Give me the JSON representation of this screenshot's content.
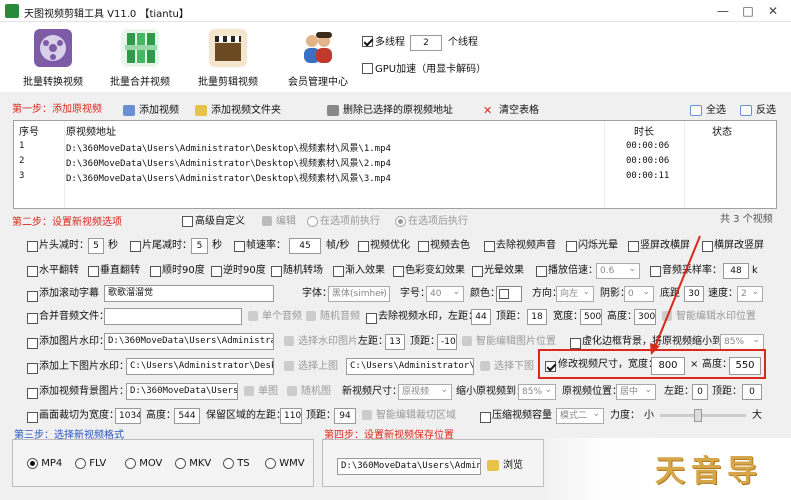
{
  "window": {
    "title": "天图视频剪辑工具 V11.0 【tiantu】",
    "minimize": "—",
    "maximize": "□",
    "close": "✕"
  },
  "toolbar": {
    "buttons": [
      {
        "label": "批量转换视频",
        "icon": "film-reel-icon",
        "color": "#7d5ba6"
      },
      {
        "label": "批量合并视频",
        "icon": "merge-blocks-icon",
        "color": "#2f9a4a"
      },
      {
        "label": "批量剪辑视频",
        "icon": "clapper-icon",
        "color": "#c07b2b"
      },
      {
        "label": "会员管理中心",
        "icon": "users-icon",
        "color": "#3b6fc4"
      }
    ],
    "multithread_label": "多线程",
    "thread_count": "2",
    "thread_unit": "个线程",
    "gpu_label": "GPU加速（用显卡解码）"
  },
  "step1": {
    "title": "第一步：添加原视频",
    "add_video": "添加视频",
    "add_folder": "添加视频文件夹",
    "delete_selected": "删除已选择的原视频地址",
    "clear_table": "清空表格",
    "select_all": "全选",
    "invert": "反选"
  },
  "table": {
    "headers": [
      "序号",
      "原视频地址",
      "时长",
      "状态"
    ],
    "rows": [
      {
        "index": "1",
        "path": "D:\\360MoveData\\Users\\Administrator\\Desktop\\视频素材\\风景\\1.mp4",
        "duration": "00:00:06",
        "status": ""
      },
      {
        "index": "2",
        "path": "D:\\360MoveData\\Users\\Administrator\\Desktop\\视频素材\\风景\\2.mp4",
        "duration": "00:00:06",
        "status": ""
      },
      {
        "index": "3",
        "path": "D:\\360MoveData\\Users\\Administrator\\Desktop\\视频素材\\风景\\3.mp4",
        "duration": "00:00:11",
        "status": ""
      }
    ]
  },
  "step2": {
    "title": "第二步：设置新视频选项",
    "advanced": "高级自定义",
    "edit": "编辑",
    "before": "在选项前执行",
    "after": "在选项后执行",
    "count": "共 3 个视频",
    "r1": {
      "head_trim": "片头减时：",
      "head_val": "5",
      "sec1": "秒",
      "tail_trim": "片尾减时：",
      "tail_val": "5",
      "sec2": "秒",
      "fps": "帧速率：",
      "fps_val": "45",
      "fps_unit": "帧/秒",
      "optimize": "视频优化",
      "decolor": "视频去色",
      "remove_audio": "去除视频声音",
      "flash": "闪烁光晕",
      "vsplit": "竖屏改横屏",
      "hsplit": "横屏改竖屏"
    },
    "r2": {
      "hflip": "水平翻转",
      "vflip": "垂直翻转",
      "cw90": "顺时90度",
      "ccw90": "逆时90度",
      "random_trans": "随机转场",
      "fade_in": "渐入效果",
      "color_change": "色彩变幻效果",
      "light": "光晕效果",
      "speed": "播放倍速：",
      "speed_val": "0.6",
      "audio_rate": "音频采样率：",
      "audio_rate_val": "48",
      "audio_unit": "k"
    },
    "r3": {
      "scroll": "添加滚动字幕",
      "scroll_text": "歌歌溜溜觉",
      "font": "字体：",
      "font_val": "黑体(simhei)",
      "size": "字号：",
      "size_val": "40",
      "color": "颜色：",
      "dir": "方向：",
      "dir_val": "向左",
      "shadow": "阴影：",
      "shadow_val": "0",
      "bottom": "底距",
      "bottom_val": "30",
      "speed": "速度：",
      "speed_val": "2"
    },
    "r4": {
      "merge_audio": "合并音频文件：",
      "single_audio": "单个音频",
      "random_audio": "随机音频",
      "remove_wm": "去除视频水印，左距：",
      "left_val": "44",
      "top": "顶距：",
      "top_val": "18",
      "width": "宽度：",
      "width_val": "500",
      "height": "高度：",
      "height_val": "300",
      "smart_wm": "智能编辑水印位置"
    },
    "r5": {
      "add_img_wm": "添加图片水印：",
      "img_path": "D:\\360MoveData\\Users\\Administrator\\De",
      "select_wm": "选择水印图片",
      "left": "左距：",
      "left_val": "13",
      "top": "顶距：",
      "top_val": "-104",
      "smart_img": "智能编辑图片位置",
      "blur_bg": "虚化边框背景，将原视频缩小到：",
      "blur_val": "85%"
    },
    "r6": {
      "add_tb_img": "添加上下图片水印：",
      "top_path": "C:\\Users\\Administrator\\Desktop\\T",
      "select_top": "选择上图",
      "bot_path": "C:\\Users\\Administrator\\Deskt",
      "select_bot": "选择下图",
      "resize": "修改视频尺寸，宽度：",
      "width_val": "800",
      "x": "×",
      "height": "高度：",
      "height_val": "550"
    },
    "r7": {
      "add_bg": "添加视频背景图片：",
      "bg_path": "D:\\360MoveData\\Users\\Adm",
      "single": "单图",
      "random": "随机图",
      "new_size": "新视频尺寸：",
      "new_size_val": "原视频",
      "scale": "缩小原视频到：",
      "scale_val": "85%",
      "pos": "原视频位置：",
      "pos_val": "居中",
      "left": "左距：",
      "left_val": "0",
      "top": "顶距：",
      "top_val": "0"
    },
    "r8": {
      "crop": "画面裁切为宽度：",
      "crop_w": "1034",
      "height": "高度：",
      "crop_h": "544",
      "keep_left": "保留区域的左距：",
      "left_val": "110",
      "top": "顶距：",
      "top_val": "94",
      "smart_crop": "智能编辑裁切区域",
      "compress": "压缩视频容量",
      "compress_mode": "模式二",
      "strength": "力度：",
      "small": "小",
      "big": "大"
    }
  },
  "step3": {
    "title": "第三步：选择新视频格式",
    "formats": [
      "MP4",
      "FLV",
      "MOV",
      "MKV",
      "TS",
      "WMV"
    ]
  },
  "step4": {
    "title": "第四步：设置新视频保存位置",
    "path": "D:\\360MoveData\\Users\\Administr",
    "browse": "浏览"
  },
  "watermark": {
    "text": "天音导"
  }
}
